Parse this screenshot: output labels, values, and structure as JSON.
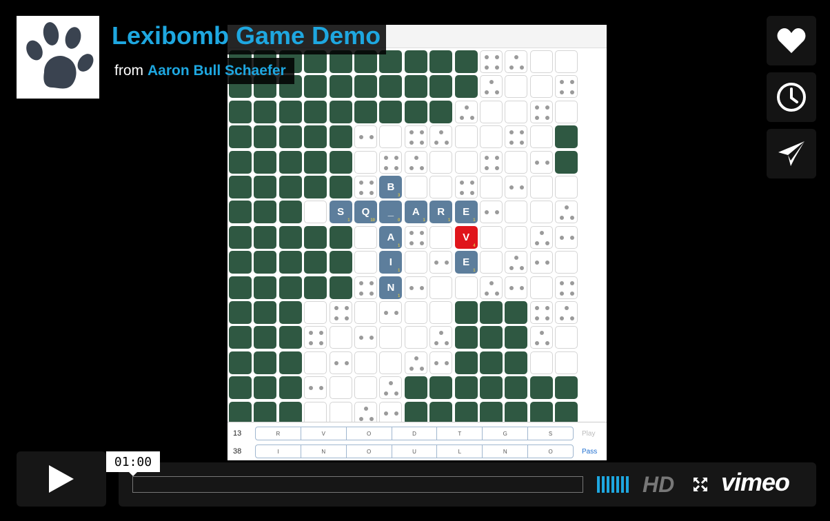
{
  "video": {
    "title": "Lexibomb Game Demo",
    "byline_prefix": "from",
    "author": "Aaron Bull Schaefer"
  },
  "player": {
    "time_tooltip": "01:00",
    "hd_label": "HD",
    "brand": "vimeo",
    "accent_color": "#1ea7e0"
  },
  "side_buttons": [
    {
      "name": "like-button",
      "icon": "heart-icon"
    },
    {
      "name": "watch-later-button",
      "icon": "clock-icon"
    },
    {
      "name": "share-button",
      "icon": "paper-plane-icon"
    }
  ],
  "game": {
    "board_rows": [
      "GGGGGGGGGGWWWW",
      "GGGGGGGGGGWWWW",
      "GGGGGGGGGWWWWW",
      "GGGGGWWWWWWWWG",
      "GGGGGWWWWWWWWG",
      "GGGGGTWWWWWWWW",
      "GGGTTTTTTWWWWW",
      "GGGGGTWWRWWWWW",
      "GGGGGTWWTWWWWW",
      "GGGGGTWWWWWWWW",
      "GGGWWWWWWGGGWW",
      "GGGWWWWWWGGGWW",
      "GGGWWWWWWGGGWW",
      "GGGWWWWGGGGGGG",
      "GGGWWWWGGGGGGG"
    ],
    "letter_tiles": [
      {
        "row": 5,
        "col": 6,
        "letter": "B",
        "points": "3"
      },
      {
        "row": 6,
        "col": 4,
        "letter": "S",
        "points": "1"
      },
      {
        "row": 6,
        "col": 5,
        "letter": "Q",
        "points": "10"
      },
      {
        "row": 6,
        "col": 6,
        "letter": "_",
        "points": "0"
      },
      {
        "row": 6,
        "col": 7,
        "letter": "A",
        "points": "1"
      },
      {
        "row": 6,
        "col": 8,
        "letter": "R",
        "points": "1"
      },
      {
        "row": 6,
        "col": 9,
        "letter": "E",
        "points": "1"
      },
      {
        "row": 7,
        "col": 6,
        "letter": "A",
        "points": "1"
      },
      {
        "row": 7,
        "col": 9,
        "letter": "V",
        "points": "4",
        "highlight": true
      },
      {
        "row": 8,
        "col": 6,
        "letter": "I",
        "points": "1"
      },
      {
        "row": 8,
        "col": 9,
        "letter": "E",
        "points": "1"
      },
      {
        "row": 9,
        "col": 6,
        "letter": "N",
        "points": "1"
      }
    ],
    "racks": [
      {
        "score": "13",
        "letters": [
          "R",
          "V",
          "O",
          "D",
          "T",
          "G",
          "S"
        ],
        "action": "Play",
        "faded": true
      },
      {
        "score": "38",
        "letters": [
          "I",
          "N",
          "O",
          "U",
          "L",
          "N",
          "O"
        ],
        "action": "Pass",
        "faded": false
      }
    ],
    "colors": {
      "unrevealed": "#2f5842",
      "revealed": "#ffffff",
      "tile": "#5d7e9c",
      "active_tile": "#e0151b"
    }
  }
}
